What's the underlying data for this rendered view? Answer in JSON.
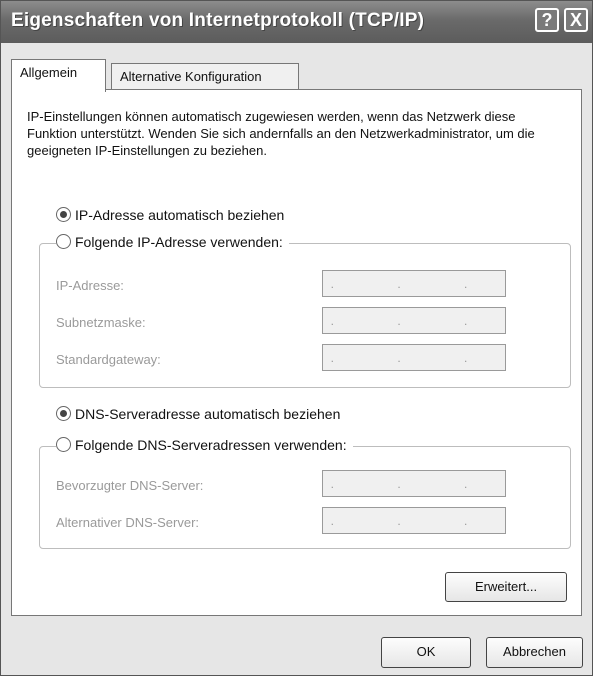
{
  "window": {
    "title": "Eigenschaften von Internetprotokoll (TCP/IP)",
    "help_label": "?",
    "close_label": "X"
  },
  "tabs": [
    {
      "label": "Allgemein",
      "active": true
    },
    {
      "label": "Alternative Konfiguration",
      "active": false
    }
  ],
  "intro_text": "IP-Einstellungen können automatisch zugewiesen werden, wenn das Netzwerk diese Funktion unterstützt. Wenden Sie sich andernfalls an den Netzwerkadministrator, um die geeigneten IP-Einstellungen zu beziehen.",
  "ip_options": {
    "auto_label": "IP-Adresse automatisch beziehen",
    "manual_label": "Folgende IP-Adresse verwenden:",
    "selected": "auto"
  },
  "ip_fields": [
    {
      "label": "IP-Adresse:",
      "value": ". . ."
    },
    {
      "label": "Subnetzmaske:",
      "value": ". . ."
    },
    {
      "label": "Standardgateway:",
      "value": ". . ."
    }
  ],
  "dns_options": {
    "auto_label": "DNS-Serveradresse automatisch beziehen",
    "manual_label": "Folgende DNS-Serveradressen verwenden:",
    "selected": "auto"
  },
  "dns_fields": [
    {
      "label": "Bevorzugter DNS-Server:",
      "value": ". . ."
    },
    {
      "label": "Alternativer DNS-Server:",
      "value": ". . ."
    }
  ],
  "buttons": {
    "advanced": "Erweitert...",
    "ok": "OK",
    "cancel": "Abbrechen"
  }
}
